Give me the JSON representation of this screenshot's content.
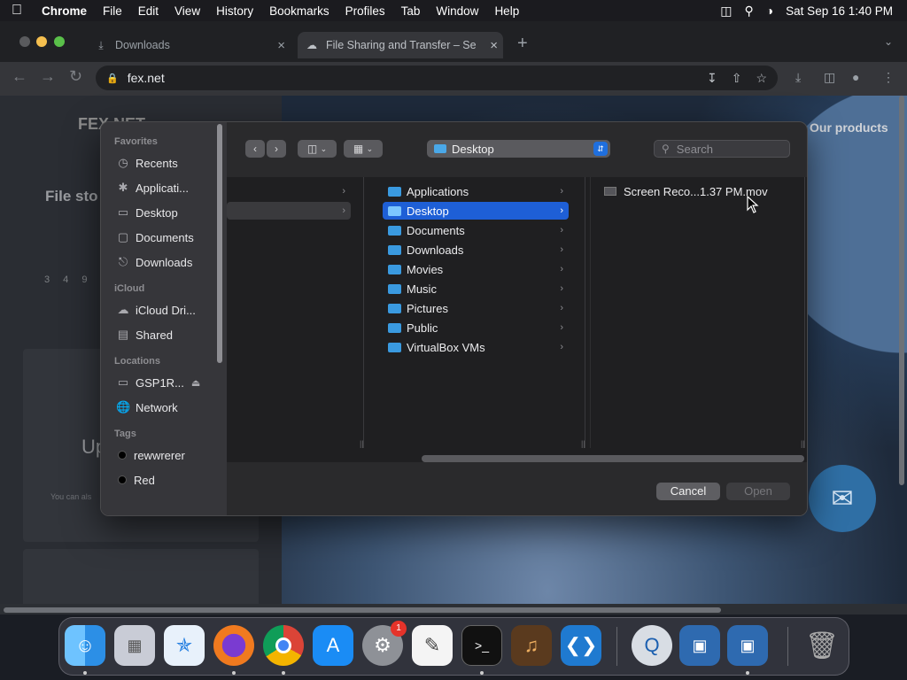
{
  "menubar": {
    "app": "Chrome",
    "items": [
      "File",
      "Edit",
      "View",
      "History",
      "Bookmarks",
      "Profiles",
      "Tab",
      "Window",
      "Help"
    ],
    "datetime": "Sat Sep 16  1:40 PM"
  },
  "browser": {
    "tabs": [
      {
        "title": "Downloads",
        "icon": "download-icon",
        "active": false
      },
      {
        "title": "File Sharing and Transfer – Se",
        "icon": "fex-favicon",
        "active": true
      }
    ],
    "url": "fex.net"
  },
  "page": {
    "brand": "FEX.NET",
    "products": "Our products",
    "file_storage": "File sto",
    "numbers": "3 4 9",
    "upload_heading": "Up",
    "upload_sub": "You can als"
  },
  "dialog": {
    "sidebar": {
      "favorites_title": "Favorites",
      "favorites": [
        {
          "label": "Recents",
          "icon": "clock-icon"
        },
        {
          "label": "Applicati...",
          "icon": "apps-icon"
        },
        {
          "label": "Desktop",
          "icon": "desktop-icon"
        },
        {
          "label": "Documents",
          "icon": "document-icon"
        },
        {
          "label": "Downloads",
          "icon": "download-icon"
        }
      ],
      "icloud_title": "iCloud",
      "icloud": [
        {
          "label": "iCloud Dri...",
          "icon": "cloud-icon"
        },
        {
          "label": "Shared",
          "icon": "shared-folder-icon"
        }
      ],
      "locations_title": "Locations",
      "locations": [
        {
          "label": "GSP1R...",
          "icon": "drive-icon"
        },
        {
          "label": "Network",
          "icon": "globe-icon"
        }
      ],
      "tags_title": "Tags",
      "tags": [
        {
          "label": "rewwrerer",
          "color": "#000000"
        },
        {
          "label": "Red",
          "color": "#000000"
        }
      ]
    },
    "path_location": "Desktop",
    "search_placeholder": "Search",
    "folders": [
      "Applications",
      "Desktop",
      "Documents",
      "Downloads",
      "Movies",
      "Music",
      "Pictures",
      "Public",
      "VirtualBox VMs"
    ],
    "selected_folder": "Desktop",
    "files": [
      "Screen Reco...1.37 PM.mov"
    ],
    "cancel_label": "Cancel",
    "open_label": "Open"
  },
  "dock": {
    "apps": [
      "Finder",
      "Launchpad",
      "Safari",
      "Firefox",
      "Chrome",
      "App Store",
      "System Settings",
      "TextEdit",
      "Terminal",
      "GarageBand",
      "Visual Studio Code",
      "QuickTime Player",
      "VirtualBox",
      "VirtualBox VM",
      "Trash"
    ],
    "settings_badge": "1"
  }
}
